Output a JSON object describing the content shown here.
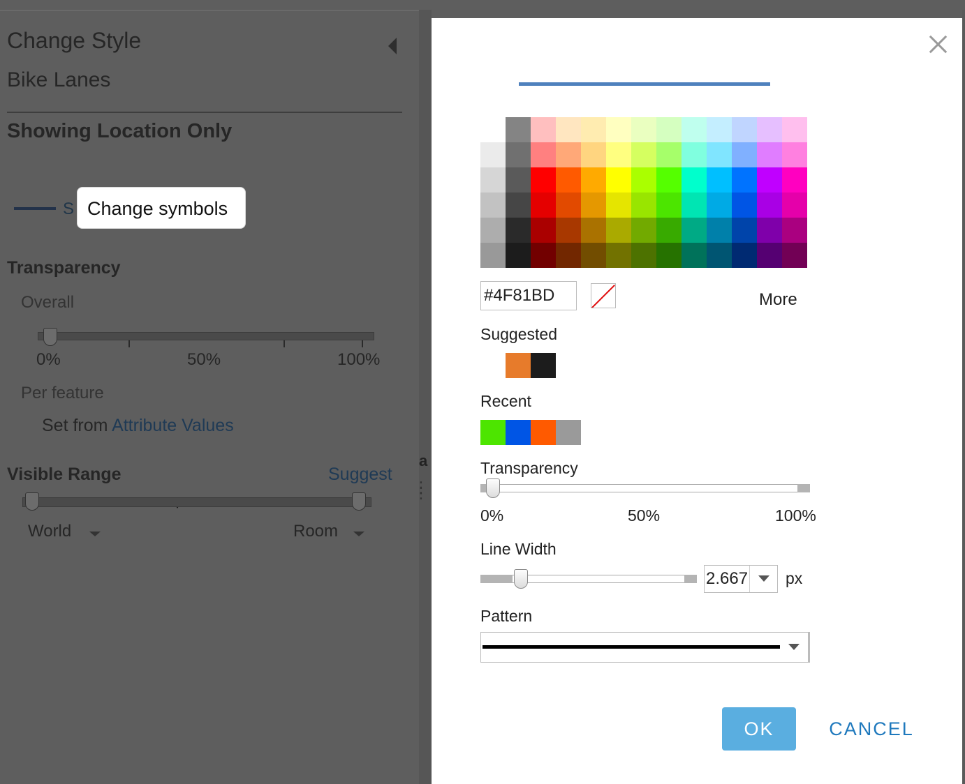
{
  "side_panel": {
    "title": "Change Style",
    "layer_name": "Bike Lanes",
    "section_heading": "Showing Location Only",
    "symbol_link_partial": "S",
    "change_symbols_tooltip": "Change symbols",
    "transparency": {
      "heading": "Transparency",
      "overall_label": "Overall",
      "value_percent": 5,
      "ticks": [
        "0%",
        "50%",
        "100%"
      ],
      "per_feature_label": "Per feature",
      "set_from_label": "Set from",
      "attribute_values_link": "Attribute Values"
    },
    "visible_range": {
      "heading": "Visible Range",
      "suggest_link": "Suggest",
      "min_scale": "World",
      "max_scale": "Room"
    }
  },
  "map_edge_char": "a",
  "dialog": {
    "preview_color": "#4F81BD",
    "palette": [
      [
        "#ffffff",
        "#848484",
        "#ffbfbf",
        "#ffe6c0",
        "#ffecb0",
        "#ffffc0",
        "#eaffc0",
        "#d5ffc0",
        "#bfffee",
        "#c4eeff",
        "#c0d5ff",
        "#e6bfff",
        "#ffbfee"
      ],
      [
        "#ebebeb",
        "#707070",
        "#ff8080",
        "#ffa878",
        "#ffd580",
        "#ffff80",
        "#d5ff60",
        "#a6ff6a",
        "#80ffdf",
        "#80e5ff",
        "#80b0ff",
        "#e07dff",
        "#ff80e0"
      ],
      [
        "#d6d6d6",
        "#5a5a5a",
        "#ff0000",
        "#ff5a00",
        "#ffaa00",
        "#ffff00",
        "#aaff00",
        "#55ff00",
        "#00ffcc",
        "#00bfff",
        "#0073ff",
        "#c000ff",
        "#ff00c0"
      ],
      [
        "#c2c2c2",
        "#464646",
        "#e50000",
        "#e24a00",
        "#e59800",
        "#e5e500",
        "#99e500",
        "#4ce500",
        "#00e5b3",
        "#00aae5",
        "#0055e5",
        "#a900e5",
        "#e500aa"
      ],
      [
        "#adadad",
        "#2a2a2a",
        "#aa0000",
        "#a83800",
        "#aa7200",
        "#aaaa00",
        "#72aa00",
        "#38aa00",
        "#00aa85",
        "#0080aa",
        "#0044aa",
        "#7f00aa",
        "#aa0080"
      ],
      [
        "#999999",
        "#1c1c1c",
        "#720000",
        "#722700",
        "#724d00",
        "#727200",
        "#4d7200",
        "#267200",
        "#00725a",
        "#005572",
        "#002a72",
        "#550072",
        "#720055"
      ]
    ],
    "hex_value": "#4F81BD",
    "more_label": "More",
    "suggested_label": "Suggested",
    "suggested_colors": [
      "#e77b2b",
      "#1c1c1c"
    ],
    "recent_label": "Recent",
    "recent_colors": [
      "#4de500",
      "#0055e5",
      "#ff5a00",
      "#9a9a9a"
    ],
    "transparency_label": "Transparency",
    "transparency_value_percent": 0,
    "transparency_ticks": [
      "0%",
      "50%",
      "100%"
    ],
    "line_width_label": "Line Width",
    "line_width_value": "2.667",
    "line_width_unit": "px",
    "pattern_label": "Pattern",
    "pattern_value": "solid",
    "ok_label": "OK",
    "cancel_label": "CANCEL"
  }
}
